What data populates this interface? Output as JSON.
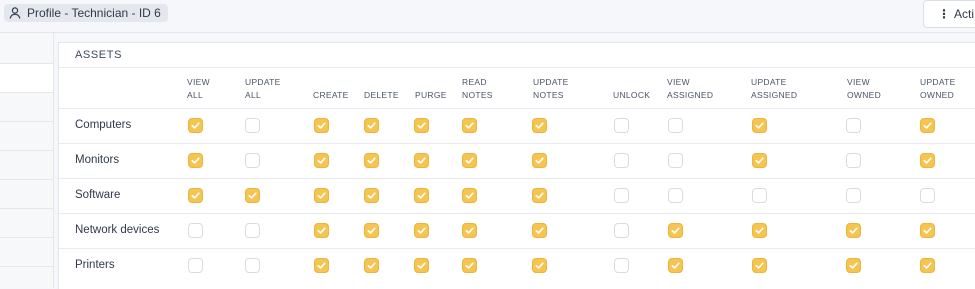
{
  "header": {
    "profile_label": "Profile -  Technician - ID 6",
    "actions_label": "Acti"
  },
  "section": {
    "title": "ASSETS"
  },
  "columns": [
    "VIEW\nALL",
    "UPDATE\nALL",
    "CREATE",
    "DELETE",
    "PURGE",
    "READ\nNOTES",
    "UPDATE\nNOTES",
    "UNLOCK",
    "VIEW\nASSIGNED",
    "UPDATE\nASSIGNED",
    "VIEW\nOWNED",
    "UPDATE\nOWNED"
  ],
  "rows": [
    {
      "label": "Computers",
      "checks": [
        true,
        false,
        true,
        true,
        true,
        true,
        true,
        false,
        false,
        true,
        false,
        true
      ]
    },
    {
      "label": "Monitors",
      "checks": [
        true,
        false,
        true,
        true,
        true,
        true,
        true,
        false,
        false,
        true,
        false,
        true
      ]
    },
    {
      "label": "Software",
      "checks": [
        true,
        true,
        true,
        true,
        true,
        true,
        true,
        false,
        false,
        false,
        false,
        false
      ]
    },
    {
      "label": "Network devices",
      "checks": [
        false,
        false,
        true,
        true,
        true,
        true,
        true,
        false,
        true,
        true,
        true,
        true
      ]
    },
    {
      "label": "Printers",
      "checks": [
        false,
        false,
        true,
        true,
        true,
        true,
        true,
        false,
        true,
        true,
        true,
        true
      ]
    }
  ],
  "colors": {
    "checked": "#f5c451",
    "unchecked_border": "#d7dce3"
  },
  "icons": {
    "profile": "user-icon",
    "actions": "kebab-icon",
    "check": "check-icon"
  }
}
